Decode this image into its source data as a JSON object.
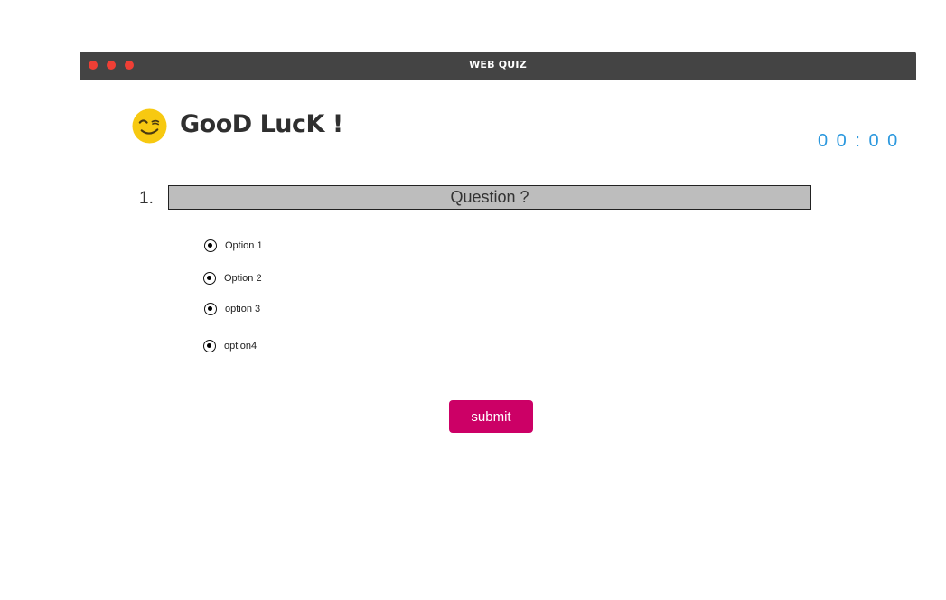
{
  "window": {
    "title": "WEB QUIZ",
    "titlebar_color": "#444444",
    "dots": [
      {
        "name": "close",
        "color": "#ef3f35"
      },
      {
        "name": "minimize",
        "color": "#ef3f35"
      },
      {
        "name": "maximize",
        "color": "#ef3f35"
      }
    ]
  },
  "header": {
    "emoji_icon": "winking-face-icon",
    "title": "GooD LucK !"
  },
  "timer": {
    "text": "0 0 : 0 0",
    "color": "#2b98de"
  },
  "question": {
    "number": "1.",
    "text": "Question ?"
  },
  "options": [
    {
      "label": "Option 1"
    },
    {
      "label": "Option 2"
    },
    {
      "label": "option 3"
    },
    {
      "label": "option4"
    }
  ],
  "submit": {
    "label": "submit",
    "color": "#cc0066"
  }
}
